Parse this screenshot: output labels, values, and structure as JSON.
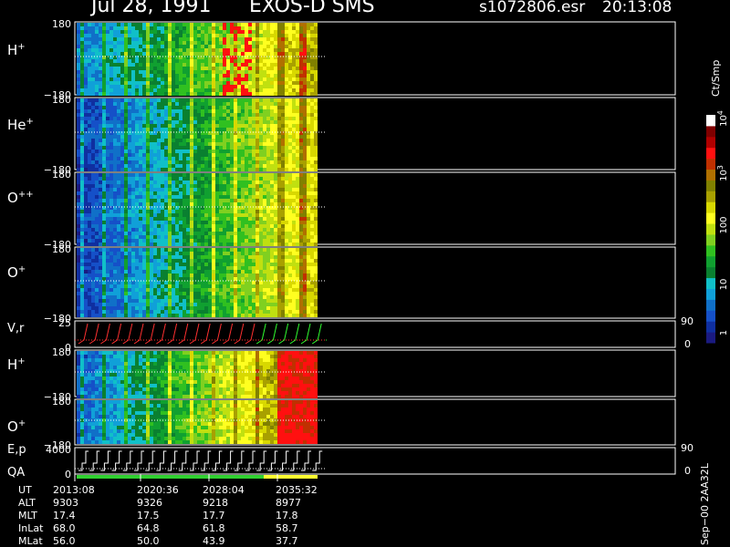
{
  "header": {
    "date": "Jul 28, 1991",
    "instrument": "EXOS-D SMS",
    "file": "s1072806.esr",
    "time": "20:13:08"
  },
  "colorbar": {
    "unit": "Ct/Smp",
    "ticks": [
      {
        "label": "1",
        "exp": null
      },
      {
        "label": "10",
        "exp": null
      },
      {
        "label": "100",
        "exp": null
      },
      {
        "label": "10",
        "exp": "3"
      },
      {
        "label": "10",
        "exp": "4"
      }
    ],
    "colors": [
      "#1a1a80",
      "#0f2fa0",
      "#1550c8",
      "#1070c8",
      "#10a0d8",
      "#10c0c8",
      "#0a8030",
      "#10a030",
      "#30c020",
      "#80d020",
      "#c0e010",
      "#ffff20",
      "#d8d800",
      "#a8a000",
      "#808000",
      "#b07000",
      "#c03000",
      "#ff1010",
      "#b00000",
      "#800000",
      "#ffffff"
    ]
  },
  "panels": [
    {
      "label": "H",
      "sup": "+",
      "ytop": "180",
      "ybot": "−180"
    },
    {
      "label": "He",
      "sup": "+",
      "ytop": "180",
      "ybot": "−180"
    },
    {
      "label": "O",
      "sup": "++",
      "ytop": "180",
      "ybot": "−180"
    },
    {
      "label": "O",
      "sup": "+",
      "ytop": "180",
      "ybot": "−180"
    },
    {
      "label": "V,r",
      "sup": "",
      "ytop": "25",
      "ybot": "0",
      "rtop": "90",
      "rbot": "0"
    },
    {
      "label": "H",
      "sup": "+",
      "ytop": "180",
      "ybot": "−180"
    },
    {
      "label": "O",
      "sup": "+",
      "ytop": "180",
      "ybot": "−180"
    },
    {
      "label": "E,p",
      "sup": "",
      "ytop": "4000",
      "ybot": "0",
      "rtop": "90",
      "rbot": "0"
    }
  ],
  "qa_label": "QA",
  "side_note": "Sep−00 2AA32L",
  "ephemeris": {
    "rows": [
      {
        "name": "UT",
        "values": [
          "2013:08",
          "2020:36",
          "2028:04",
          "2035:32"
        ]
      },
      {
        "name": "ALT",
        "values": [
          "9303",
          "9326",
          "9218",
          "8977"
        ]
      },
      {
        "name": "MLT",
        "values": [
          "17.4",
          "17.5",
          "17.7",
          "17.8"
        ]
      },
      {
        "name": "InLat",
        "values": [
          "68.0",
          "64.8",
          "61.8",
          "58.7"
        ]
      },
      {
        "name": "MLat",
        "values": [
          "56.0",
          "50.0",
          "43.9",
          "37.7"
        ]
      }
    ]
  }
}
